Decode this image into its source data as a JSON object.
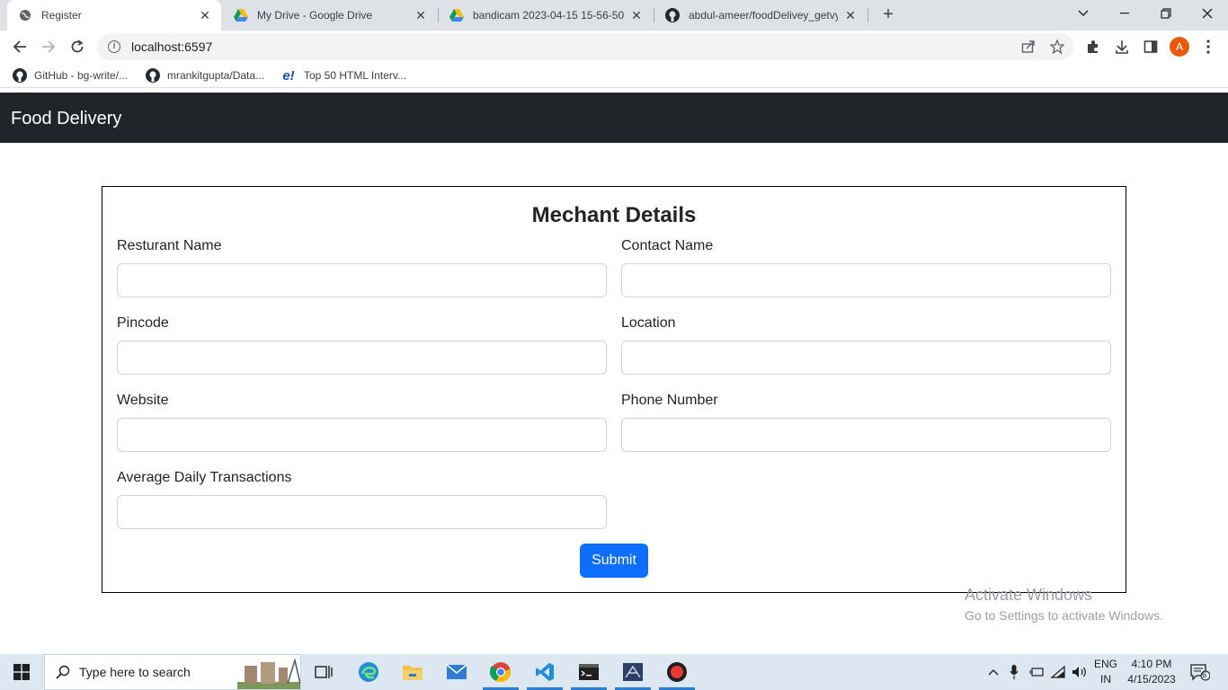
{
  "browser": {
    "tabs": [
      {
        "title": "Register",
        "icon": "globe-icon"
      },
      {
        "title": "My Drive - Google Drive",
        "icon": "google-drive-icon"
      },
      {
        "title": "bandicam 2023-04-15 15-56-50-",
        "icon": "google-drive-icon"
      },
      {
        "title": "abdul-ameer/foodDelivey_getvy",
        "icon": "github-icon"
      }
    ],
    "new_tab_symbol": "+",
    "tab_close_symbol": "✕",
    "url": "localhost:6597",
    "profile_initial": "A",
    "bookmarks": [
      {
        "label": "GitHub - bg-write/...",
        "icon": "github-icon"
      },
      {
        "label": "mrankitgupta/Data...",
        "icon": "github-icon"
      },
      {
        "label": "Top 50 HTML Interv...",
        "icon": "edureka-icon"
      }
    ]
  },
  "page": {
    "brand": "Food Delivery",
    "form": {
      "title": "Mechant Details",
      "fields": {
        "restaurant_name": {
          "label": "Resturant Name",
          "value": ""
        },
        "contact_name": {
          "label": "Contact Name",
          "value": ""
        },
        "pincode": {
          "label": "Pincode",
          "value": ""
        },
        "location": {
          "label": "Location",
          "value": ""
        },
        "website": {
          "label": "Website",
          "value": ""
        },
        "phone_number": {
          "label": "Phone Number",
          "value": ""
        },
        "avg_daily_transactions": {
          "label": "Average Daily Transactions",
          "value": ""
        }
      },
      "submit_label": "Submit"
    }
  },
  "watermark": {
    "line1": "Activate Windows",
    "line2": "Go to Settings to activate Windows."
  },
  "taskbar": {
    "search_placeholder": "Type here to search",
    "language": "ENG",
    "region": "IN",
    "time": "4:10 PM",
    "date": "4/15/2023",
    "notification_count": "6"
  },
  "colors": {
    "navbar_bg": "#212529",
    "primary_button": "#0d6efd",
    "tabstrip_bg": "#dee1e6",
    "taskbar_bg": "#dde7f2"
  }
}
